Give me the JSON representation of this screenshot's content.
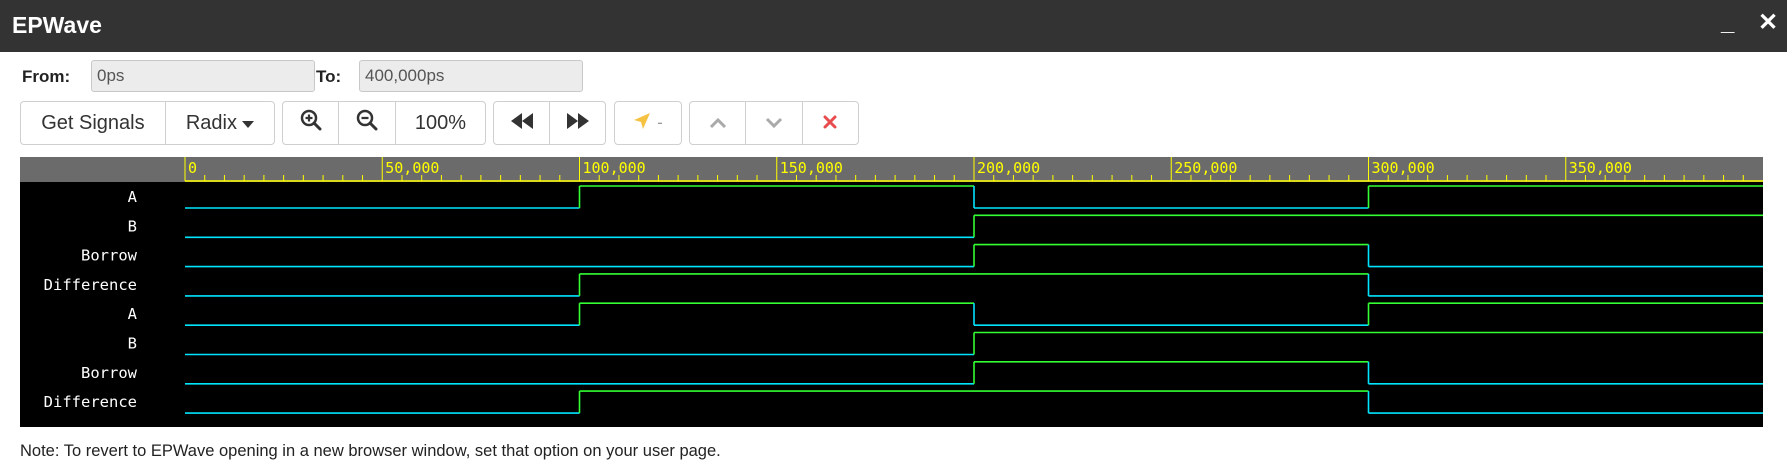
{
  "window": {
    "title": "EPWave",
    "minimize_symbol": "_",
    "close_symbol": "✕"
  },
  "range": {
    "from_label": "From:",
    "from_value": "0ps",
    "to_label": "To:",
    "to_value": "400,000ps"
  },
  "toolbar": {
    "get_signals": "Get Signals",
    "radix": "Radix",
    "zoom_level": "100%",
    "cursor_value": "-"
  },
  "timeline": {
    "tick_labels": [
      "0",
      "50,000",
      "100,000",
      "150,000",
      "200,000",
      "250,000",
      "300,000",
      "350,000"
    ],
    "range_ps": [
      0,
      400000
    ],
    "minor_tick_ps": 5000,
    "label_step_ps": 50000
  },
  "signals": [
    {
      "name": "A",
      "transitions": [
        [
          0,
          0
        ],
        [
          100000,
          1
        ],
        [
          200000,
          0
        ],
        [
          300000,
          1
        ]
      ]
    },
    {
      "name": "B",
      "transitions": [
        [
          0,
          0
        ],
        [
          200000,
          1
        ]
      ]
    },
    {
      "name": "Borrow",
      "transitions": [
        [
          0,
          0
        ],
        [
          200000,
          1
        ],
        [
          300000,
          0
        ]
      ]
    },
    {
      "name": "Difference",
      "transitions": [
        [
          0,
          0
        ],
        [
          100000,
          1
        ],
        [
          300000,
          0
        ]
      ]
    },
    {
      "name": "A",
      "transitions": [
        [
          0,
          0
        ],
        [
          100000,
          1
        ],
        [
          200000,
          0
        ],
        [
          300000,
          1
        ]
      ]
    },
    {
      "name": "B",
      "transitions": [
        [
          0,
          0
        ],
        [
          200000,
          1
        ]
      ]
    },
    {
      "name": "Borrow",
      "transitions": [
        [
          0,
          0
        ],
        [
          200000,
          1
        ],
        [
          300000,
          0
        ]
      ]
    },
    {
      "name": "Difference",
      "transitions": [
        [
          0,
          0
        ],
        [
          100000,
          1
        ],
        [
          300000,
          0
        ]
      ]
    }
  ],
  "colors": {
    "low": "#00e5ff",
    "high": "#33ff33",
    "ruler_bg": "#6b6b6b",
    "ruler_fg": "#ffff00",
    "delete": "#e84c4c",
    "cursor_icon": "#f5c242"
  },
  "note": "Note: To revert to EPWave opening in a new browser window, set that option on your user page."
}
